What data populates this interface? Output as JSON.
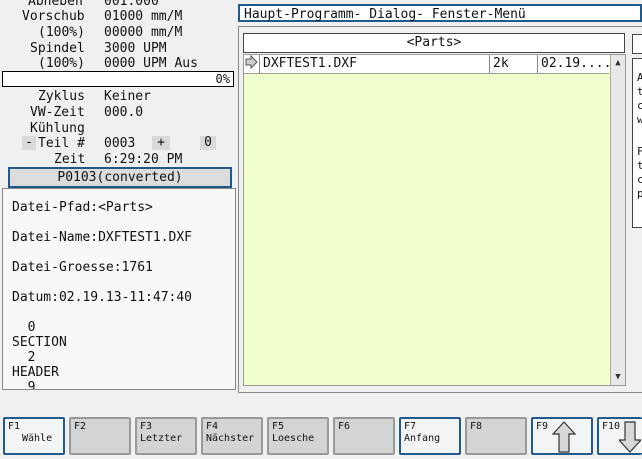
{
  "status": {
    "abheben_label": "Abheben",
    "abheben_value": "001.000",
    "vorschub_label": "Vorschub",
    "vorschub_value": "01000 mm/M",
    "vorschub_pct": "(100%)",
    "vorschub_pct_value": "00000 mm/M",
    "spindel_label": "Spindel",
    "spindel_value": "3000 UPM",
    "spindel_pct": "(100%)",
    "spindel_pct_value": "0000 UPM Aus",
    "progress_text": "0%",
    "progress_fraction": 0,
    "zyklus_label": "Zyklus",
    "zyklus_value": "Keiner",
    "vwzeit_label": "VW-Zeit",
    "vwzeit_value": "000.0",
    "kuehlung_label": "Kühlung",
    "teil_minus": "-",
    "teil_label": "Teil #",
    "teil_value": "0003",
    "teil_plus": "+",
    "teil_zero": "0",
    "zeit_label": "Zeit",
    "zeit_value": "6:29:20 PM",
    "program_name": "P0103(converted)"
  },
  "info": {
    "pfad": "Datei-Pfad:<Parts>",
    "name": "Datei-Name:DXFTEST1.DXF",
    "groesse": "Datei-Groesse:1761",
    "datum": "Datum:02.19.13-11:47:40",
    "content_lines": [
      "  0",
      "SECTION",
      "  2",
      "HEADER",
      "  9"
    ]
  },
  "menubar": "Haupt-Programm-  Dialog- Fenster-Menü",
  "browser": {
    "folder": "<Parts>",
    "files": [
      {
        "name": "DXFTEST1.DXF",
        "size": "2k",
        "date": "02.19...."
      }
    ]
  },
  "detail_partial": [
    "A",
    "t",
    "c",
    "w",
    "",
    "F",
    "t",
    "c",
    "p"
  ],
  "fkeys": [
    {
      "num": "F1",
      "label": "Wähle"
    },
    {
      "num": "F2",
      "label": ""
    },
    {
      "num": "F3",
      "label": "Letzter"
    },
    {
      "num": "F4",
      "label": "Nächster"
    },
    {
      "num": "F5",
      "label": "Loesche"
    },
    {
      "num": "F6",
      "label": ""
    },
    {
      "num": "F7",
      "label": "Anfang"
    },
    {
      "num": "F8",
      "label": ""
    },
    {
      "num": "F9",
      "label": ""
    },
    {
      "num": "F10",
      "label": ""
    }
  ]
}
